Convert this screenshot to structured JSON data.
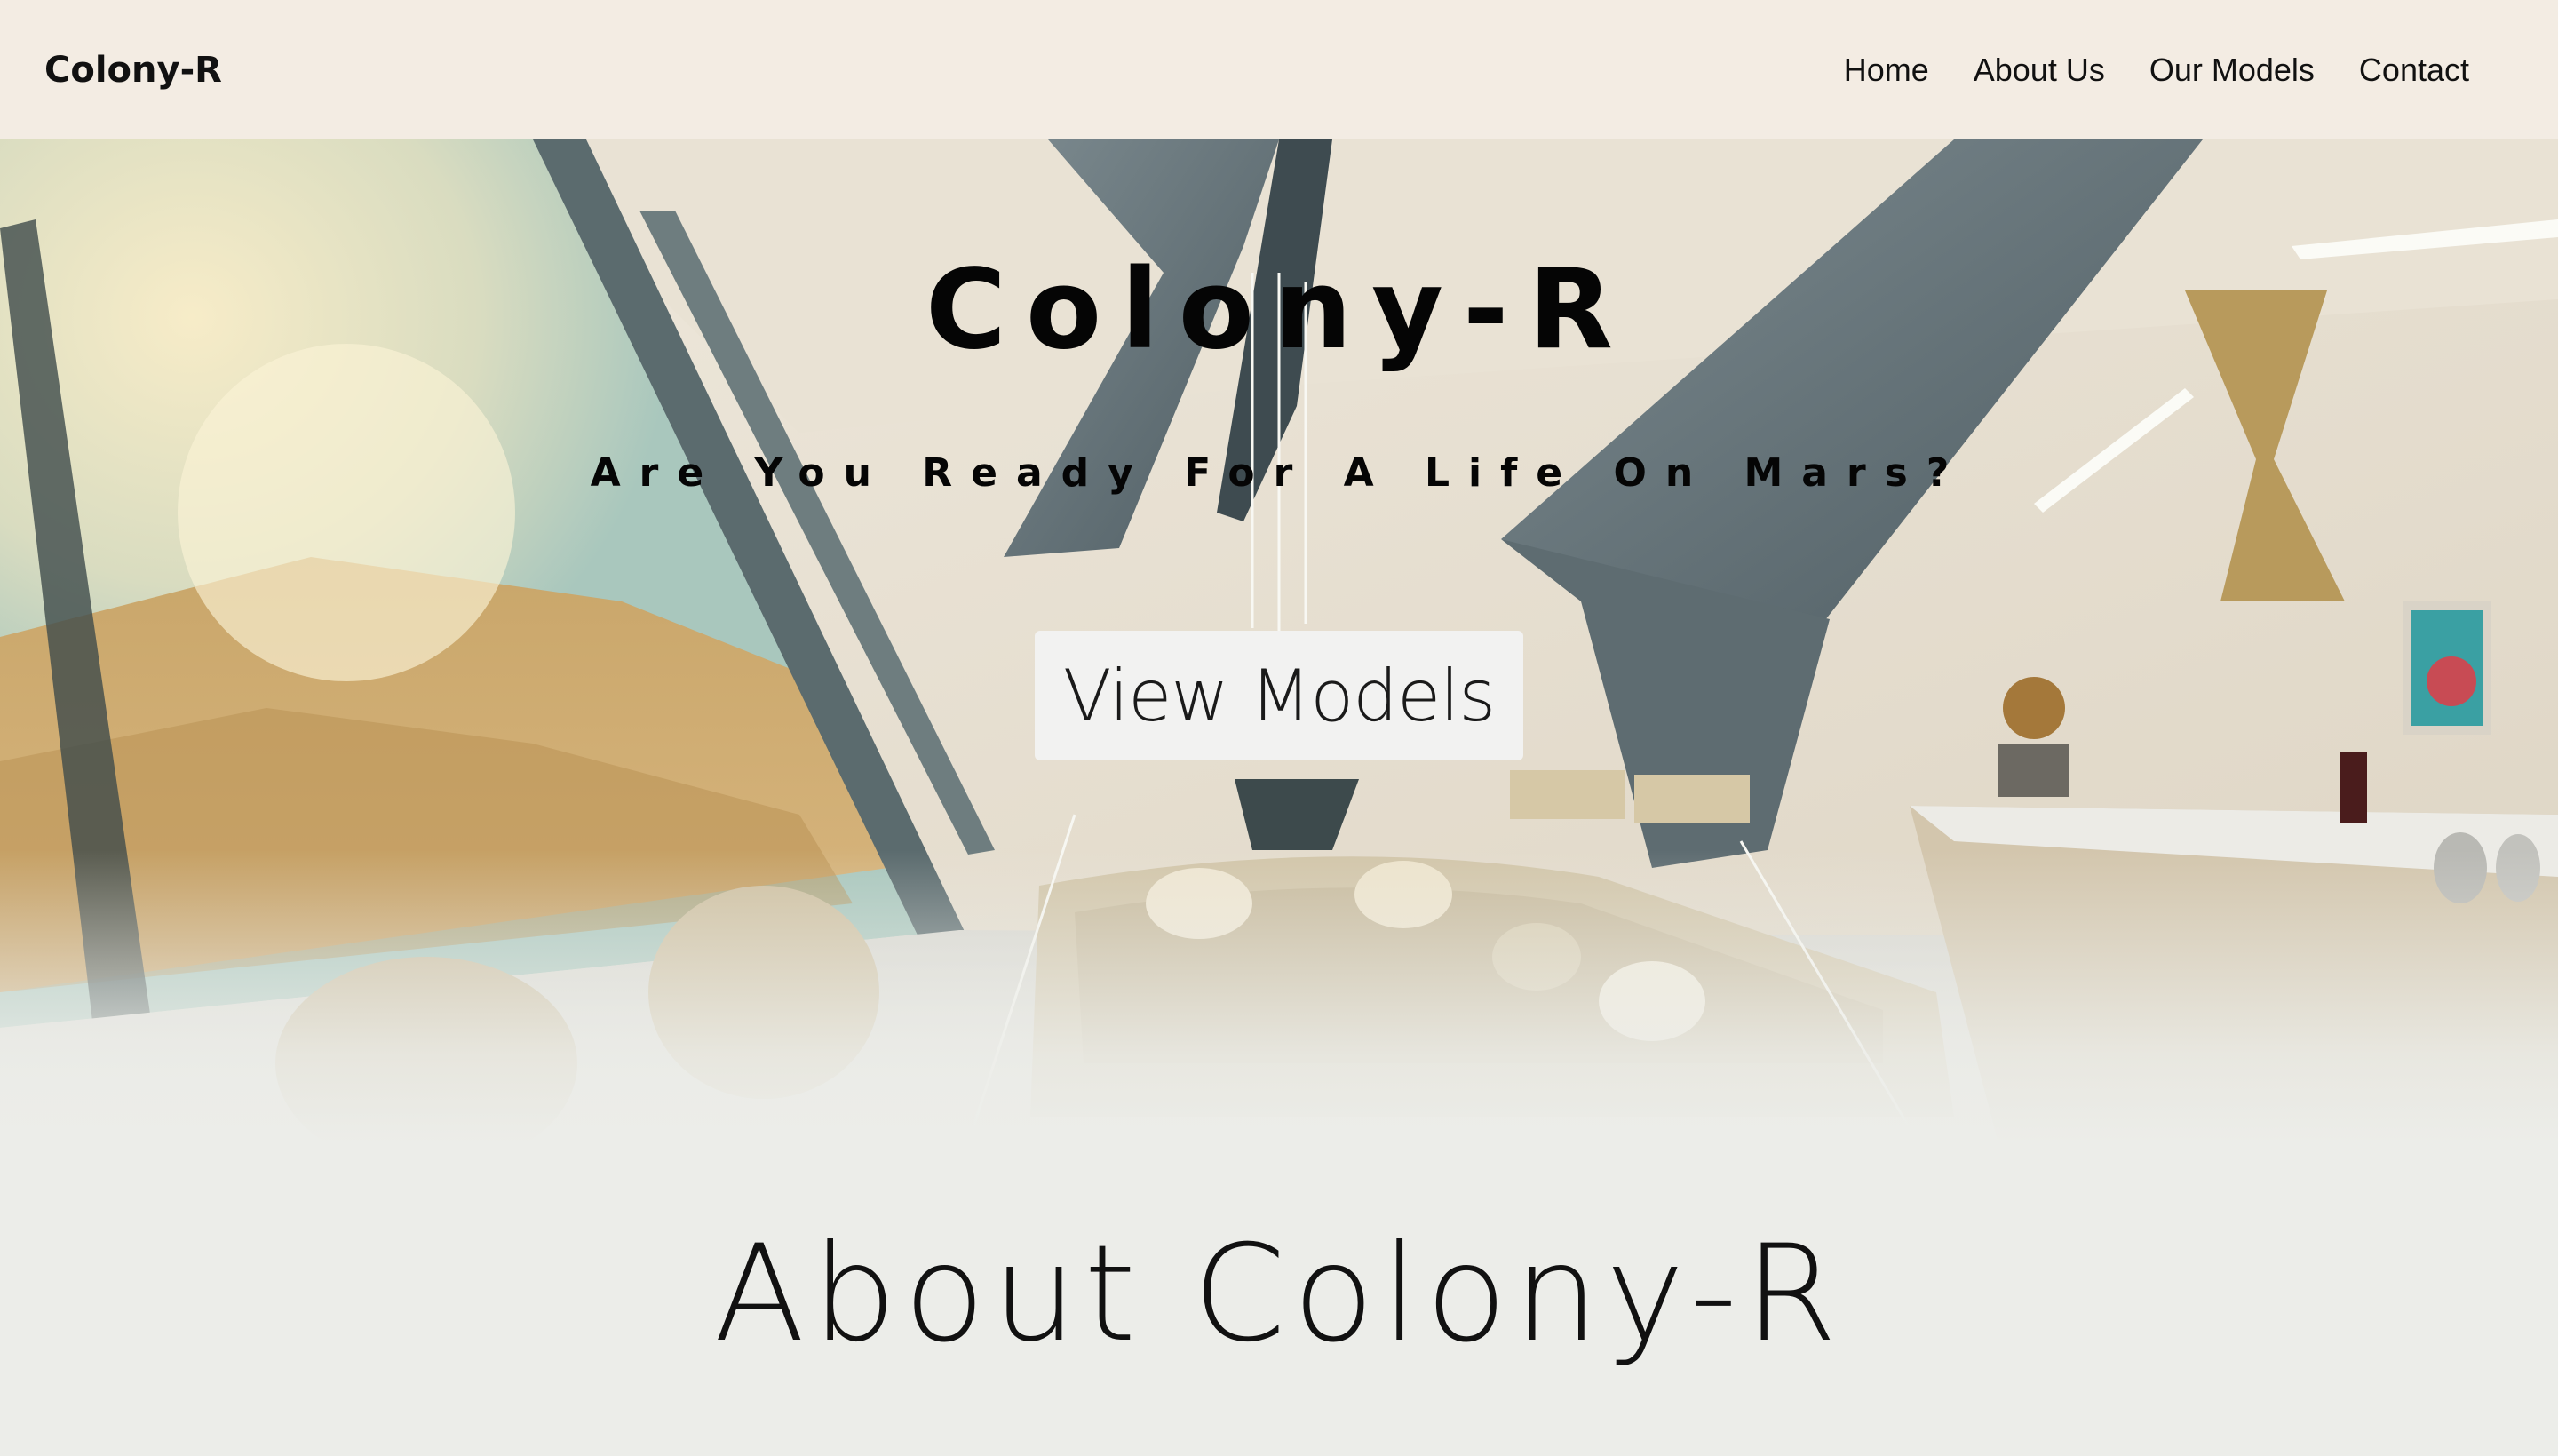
{
  "nav": {
    "brand": "Colony-R",
    "links": [
      "Home",
      "About Us",
      "Our Models",
      "Contact"
    ]
  },
  "hero": {
    "title": "Colony-R",
    "subtitle": "Are You Ready For A Life On Mars?",
    "button_label": "View Models"
  },
  "about": {
    "title": "About Colony-R"
  },
  "colors": {
    "nav_bg": "#f3ece3",
    "page_bg": "#ecede9",
    "button_bg": "#f2f2f1"
  }
}
